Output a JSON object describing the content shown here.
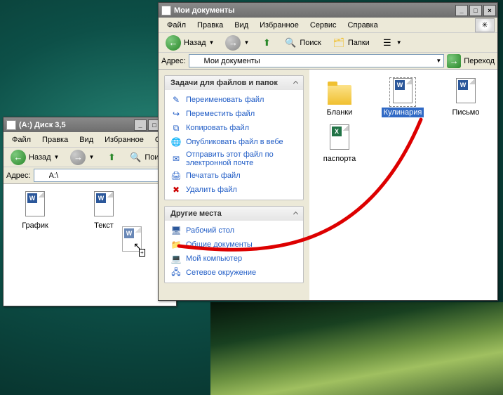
{
  "back_window": {
    "title": "(A:) Диск 3,5",
    "menu": [
      "Файл",
      "Правка",
      "Вид",
      "Избранное",
      "Се"
    ],
    "toolbar": {
      "back": "Назад",
      "search": "Поиск"
    },
    "address_label": "Адрес:",
    "address_value": "A:\\",
    "files": [
      {
        "name": "График",
        "type": "word"
      },
      {
        "name": "Текст",
        "type": "word"
      }
    ]
  },
  "front_window": {
    "title": "Мои документы",
    "menu": [
      "Файл",
      "Правка",
      "Вид",
      "Избранное",
      "Сервис",
      "Справка"
    ],
    "toolbar": {
      "back": "Назад",
      "search": "Поиск",
      "folders": "Папки"
    },
    "address_label": "Адрес:",
    "address_value": "Мои документы",
    "go_label": "Переход",
    "tasks_panel": {
      "title": "Задачи для файлов и папок",
      "items": [
        "Переименовать файл",
        "Переместить файл",
        "Копировать файл",
        "Опубликовать файл в вебе",
        "Отправить этот файл по электронной почте",
        "Печатать файл",
        "Удалить файл"
      ]
    },
    "places_panel": {
      "title": "Другие места",
      "items": [
        "Рабочий стол",
        "Общие документы",
        "Мой компьютер",
        "Сетевое окружение"
      ]
    },
    "files": [
      {
        "name": "Бланки",
        "type": "folder"
      },
      {
        "name": "Кулинария",
        "type": "word",
        "selected": true
      },
      {
        "name": "Письмо",
        "type": "word"
      },
      {
        "name": "паспорта",
        "type": "excel"
      }
    ]
  }
}
